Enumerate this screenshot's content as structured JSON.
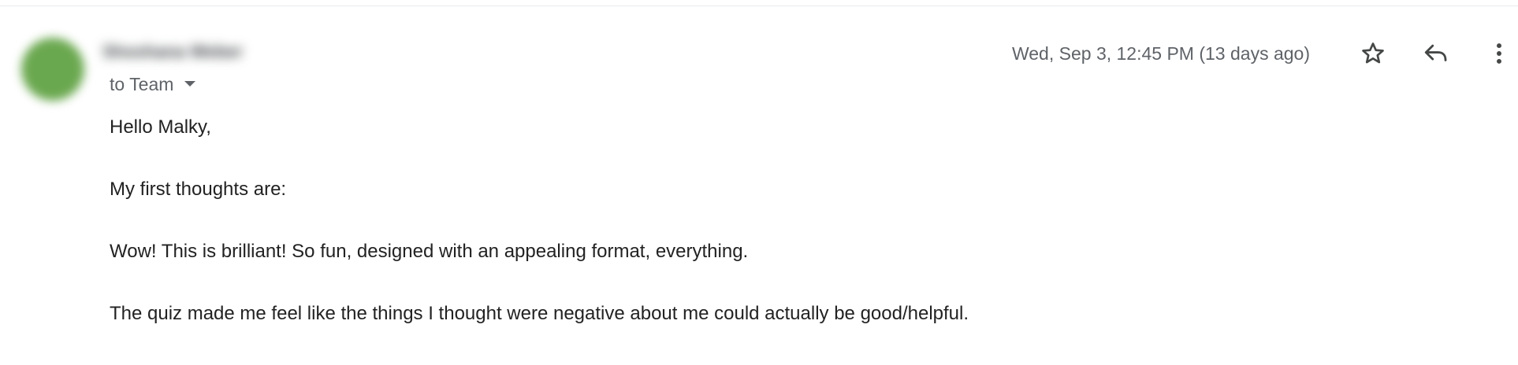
{
  "message": {
    "sender_name": "Shoshana Weber",
    "recipient_label": "to Team",
    "date": "Wed, Sep 3, 12:45 PM (13 days ago)",
    "avatar_color": "#6aa84f",
    "body_paragraphs": [
      "Hello Malky,",
      "My first thoughts are:",
      "Wow! This is brilliant! So fun, designed with an appealing format, everything.",
      "The quiz made me feel like the things I thought were negative about me could actually be good/helpful."
    ]
  },
  "icons": {
    "details": "chevron-down-icon",
    "star": "star-icon",
    "reply": "reply-icon",
    "more": "more-vertical-icon"
  }
}
